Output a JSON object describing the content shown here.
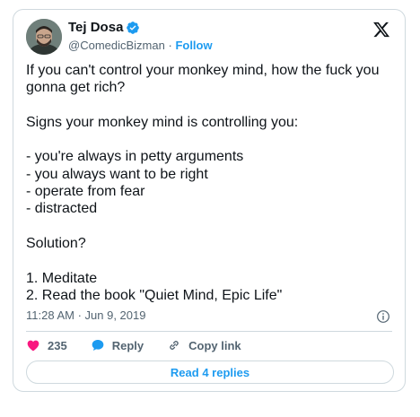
{
  "author": {
    "display_name": "Tej Dosa",
    "handle": "@ComedicBizman",
    "separator": "·",
    "follow_label": "Follow",
    "verified": true,
    "avatar_icon": "avatar-photo"
  },
  "platform_icon": "x-logo-icon",
  "tweet": {
    "text": "If you can't control your monkey mind, how the fuck you gonna get rich?\n\nSigns your monkey mind is controlling you:\n\n- you're always in petty arguments\n- you always want to be right\n- operate from fear\n- distracted\n\nSolution?\n\n1. Meditate\n2. Read the book \"Quiet Mind, Epic Life\"",
    "timestamp": "11:28 AM · Jun 9, 2019"
  },
  "actions": {
    "like_count": "235",
    "reply_label": "Reply",
    "copy_link_label": "Copy link"
  },
  "read_replies_label": "Read 4 replies",
  "colors": {
    "accent": "#1d9bf0",
    "like": "#f91880",
    "text": "#0f1419",
    "muted": "#536471",
    "border": "#cfd9de"
  }
}
